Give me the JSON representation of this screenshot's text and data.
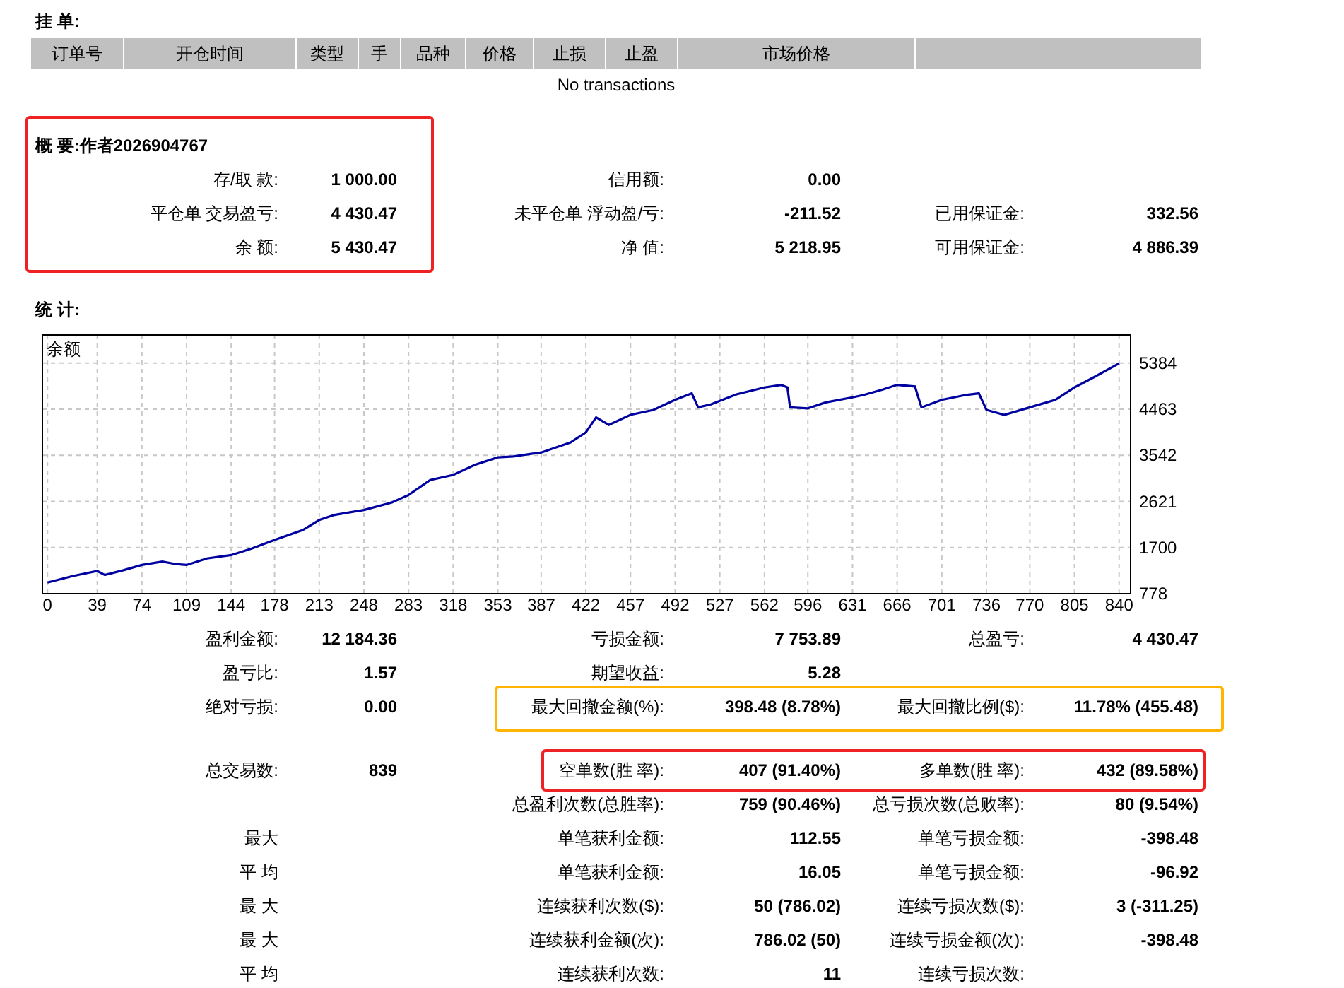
{
  "pending_orders": {
    "title": "挂 单:",
    "columns": [
      "订单号",
      "开仓时间",
      "类型",
      "手",
      "品种",
      "价格",
      "止损",
      "止盈",
      "市场价格"
    ],
    "empty_message": "No transactions"
  },
  "summary": {
    "title": "概 要:作者2026904767",
    "rows": [
      {
        "left": {
          "label": "存/取 款:",
          "value": "1 000.00"
        },
        "middle": {
          "label": "信用额:",
          "value": "0.00"
        }
      },
      {
        "left": {
          "label": "平仓单 交易盈亏:",
          "value": "4 430.47"
        },
        "middle": {
          "label": "未平仓单 浮动盈/亏:",
          "value": "-211.52"
        },
        "right": {
          "label": "已用保证金:",
          "value": "332.56"
        }
      },
      {
        "left": {
          "label": "余 额:",
          "value": "5 430.47"
        },
        "middle": {
          "label": "净 值:",
          "value": "5 218.95"
        },
        "right": {
          "label": "可用保证金:",
          "value": "4 886.39"
        }
      }
    ]
  },
  "stats": {
    "title": "统 计:",
    "chart": {
      "chart_data": {
        "type": "line",
        "grid": true,
        "xlim": [
          -4,
          849
        ],
        "ylim": [
          778,
          5947
        ],
        "xticks": [
          0,
          39,
          74,
          109,
          144,
          178,
          213,
          248,
          283,
          318,
          353,
          387,
          422,
          457,
          492,
          527,
          562,
          596,
          631,
          666,
          701,
          736,
          770,
          805,
          840
        ],
        "yticks": [
          778,
          1700,
          2621,
          3542,
          4463,
          5384
        ],
        "x": [
          0,
          20,
          39,
          45,
          60,
          74,
          90,
          100,
          109,
          125,
          144,
          160,
          178,
          200,
          213,
          225,
          248,
          270,
          283,
          300,
          318,
          335,
          353,
          365,
          387,
          410,
          422,
          430,
          440,
          457,
          475,
          492,
          505,
          510,
          520,
          540,
          562,
          575,
          580,
          582,
          596,
          610,
          631,
          640,
          655,
          666,
          680,
          685,
          701,
          720,
          730,
          736,
          750,
          770,
          790,
          805,
          820,
          840
        ],
        "series": [
          {
            "name": "余额",
            "color": "#0000a0",
            "values": [
              1000,
              1130,
              1230,
              1150,
              1250,
              1350,
              1420,
              1370,
              1350,
              1480,
              1550,
              1680,
              1850,
              2050,
              2250,
              2350,
              2450,
              2600,
              2750,
              3050,
              3150,
              3350,
              3500,
              3520,
              3600,
              3800,
              4000,
              4300,
              4150,
              4350,
              4450,
              4650,
              4780,
              4500,
              4560,
              4760,
              4900,
              4950,
              4900,
              4500,
              4480,
              4600,
              4700,
              4750,
              4860,
              4950,
              4920,
              4500,
              4650,
              4750,
              4780,
              4450,
              4350,
              4500,
              4650,
              4900,
              5100,
              5380
            ]
          }
        ]
      }
    },
    "groups": [
      [
        {
          "left": {
            "label": "盈利金额:",
            "value": "12 184.36"
          },
          "middle": {
            "label": "亏损金额:",
            "value": "7 753.89"
          },
          "right": {
            "label": "总盈亏:",
            "value": "4 430.47"
          }
        },
        {
          "left": {
            "label": "盈亏比:",
            "value": "1.57"
          },
          "middle": {
            "label": "期望收益:",
            "value": "5.28"
          }
        },
        {
          "left": {
            "label": "绝对亏损:",
            "value": "0.00"
          },
          "middle": {
            "label": "最大回撤金额(%):",
            "value": "398.48 (8.78%)"
          },
          "right": {
            "label": "最大回撤比例($):",
            "value": "11.78% (455.48)"
          }
        }
      ],
      [
        {
          "left": {
            "label": "总交易数:",
            "value": "839"
          },
          "middle": {
            "label": "空单数(胜 率):",
            "value": "407 (91.40%)"
          },
          "right": {
            "label": "多单数(胜 率):",
            "value": "432 (89.58%)"
          }
        },
        {
          "middle": {
            "label": "总盈利次数(总胜率):",
            "value": "759 (90.46%)"
          },
          "right": {
            "label": "总亏损次数(总败率):",
            "value": "80 (9.54%)"
          }
        },
        {
          "left": {
            "label": "最大"
          },
          "middle": {
            "label": "单笔获利金额:",
            "value": "112.55"
          },
          "right": {
            "label": "单笔亏损金额:",
            "value": "-398.48"
          }
        },
        {
          "left": {
            "label": "平 均"
          },
          "middle": {
            "label": "单笔获利金额:",
            "value": "16.05"
          },
          "right": {
            "label": "单笔亏损金额:",
            "value": "-96.92"
          }
        },
        {
          "left": {
            "label": "最 大"
          },
          "middle": {
            "label": "连续获利次数($):",
            "value": "50 (786.02)"
          },
          "right": {
            "label": "连续亏损次数($):",
            "value": "3 (-311.25)"
          }
        },
        {
          "left": {
            "label": "最 大"
          },
          "middle": {
            "label": "连续获利金额(次):",
            "value": "786.02 (50)"
          },
          "right": {
            "label": "连续亏损金额(次):",
            "value": "-398.48"
          }
        },
        {
          "left": {
            "label": "平 均"
          },
          "middle": {
            "label": "连续获利次数:",
            "value": "11"
          },
          "right": {
            "label": "连续亏损次数:"
          }
        }
      ]
    ]
  },
  "highlight_frames": [
    {
      "color": "#ee2222"
    },
    {
      "color": "#ffb400"
    },
    {
      "color": "#ee2222"
    }
  ]
}
